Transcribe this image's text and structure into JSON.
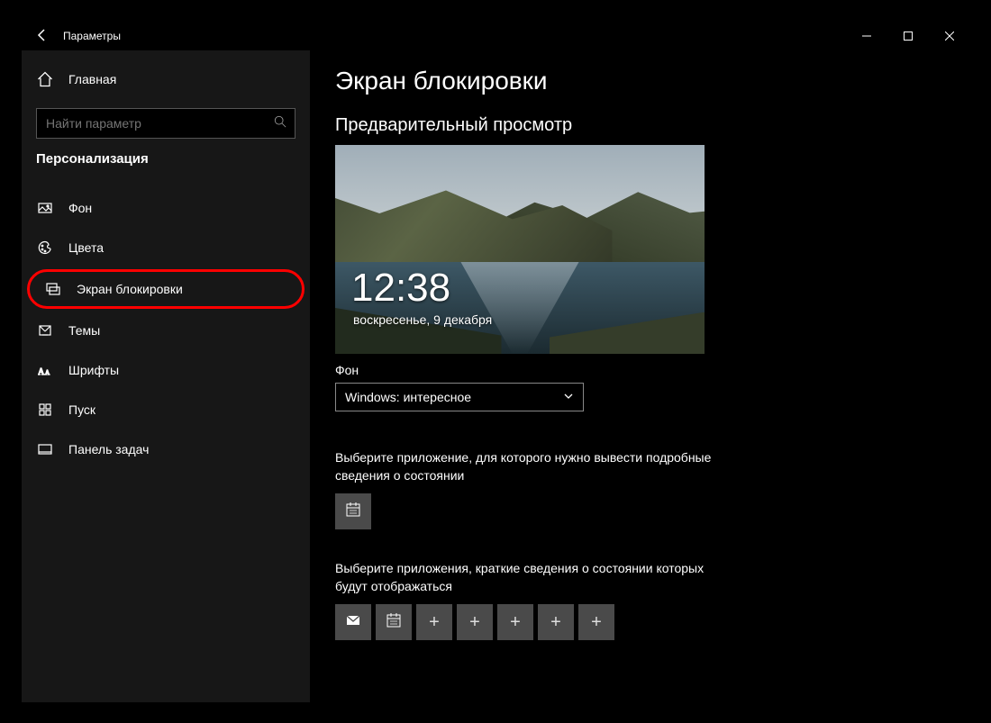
{
  "window": {
    "title": "Параметры"
  },
  "sidebar": {
    "home": "Главная",
    "search_placeholder": "Найти параметр",
    "category": "Персонализация",
    "items": [
      {
        "label": "Фон"
      },
      {
        "label": "Цвета"
      },
      {
        "label": "Экран блокировки"
      },
      {
        "label": "Темы"
      },
      {
        "label": "Шрифты"
      },
      {
        "label": "Пуск"
      },
      {
        "label": "Панель задач"
      }
    ]
  },
  "main": {
    "page_title": "Экран блокировки",
    "preview_label": "Предварительный просмотр",
    "preview_time": "12:38",
    "preview_date": "воскресенье, 9 декабря",
    "background_label": "Фон",
    "background_selected": "Windows: интересное",
    "detailed_status_text": "Выберите приложение, для которого нужно вывести подробные сведения о состоянии",
    "quick_status_text": "Выберите приложения, краткие сведения о состоянии которых будут отображаться"
  }
}
